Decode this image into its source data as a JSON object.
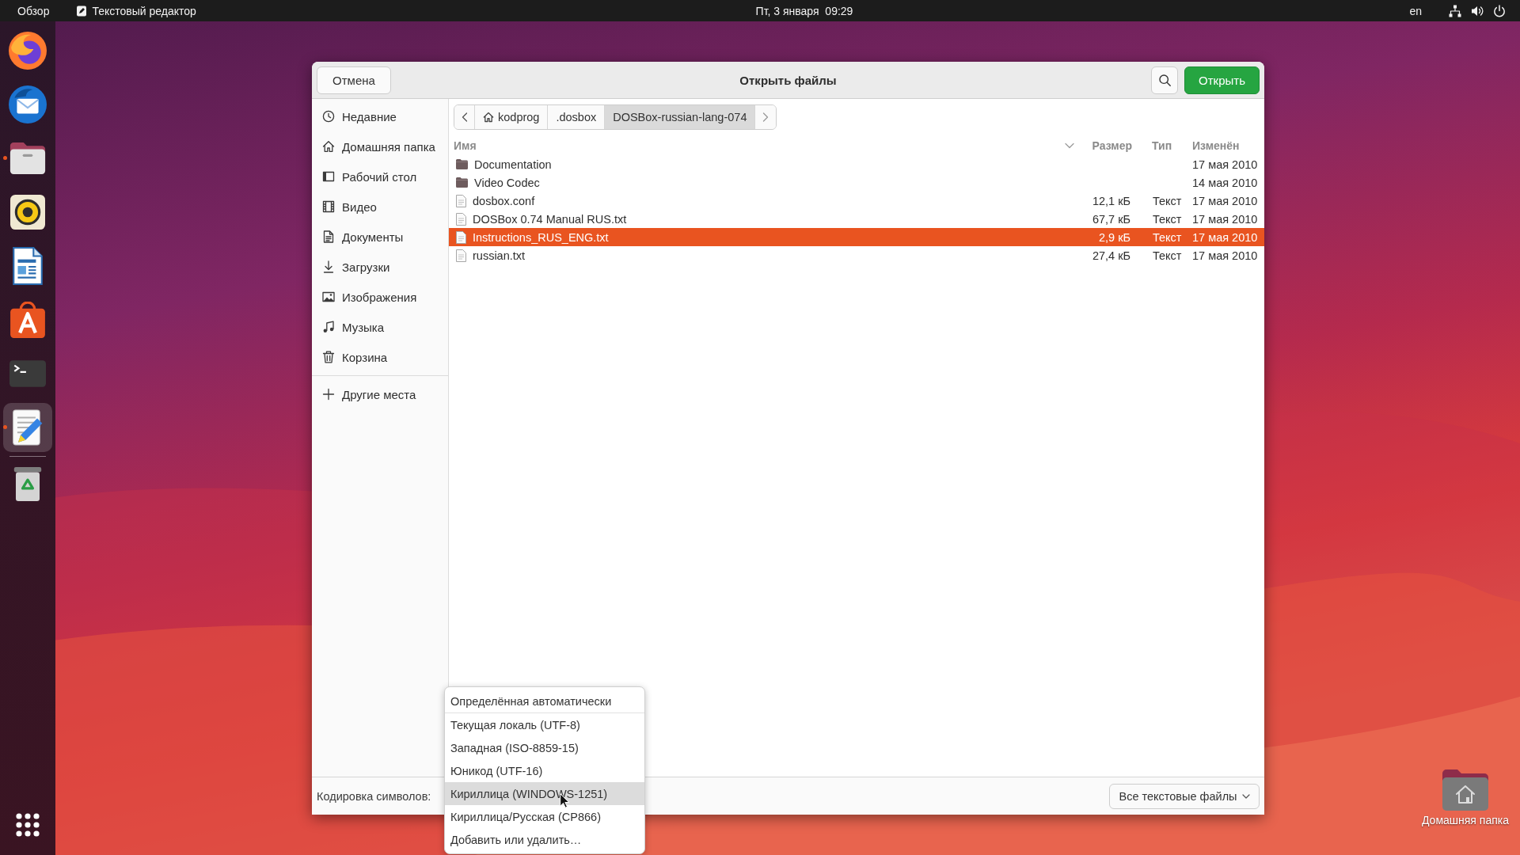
{
  "top_bar": {
    "activities": "Обзор",
    "app_menu": "Текстовый редактор",
    "clock": "Пт, 3 января  09:29",
    "keyboard_layout": "en"
  },
  "dock": {
    "apps": [
      {
        "kind": "browser",
        "running": false,
        "active": false
      },
      {
        "kind": "mail",
        "running": false,
        "active": false
      },
      {
        "kind": "files",
        "running": true,
        "active": false
      },
      {
        "kind": "music",
        "running": false,
        "active": false
      },
      {
        "kind": "writer",
        "running": false,
        "active": false
      },
      {
        "kind": "store",
        "running": false,
        "active": false
      },
      {
        "kind": "terminal",
        "running": false,
        "active": false
      },
      {
        "kind": "editor",
        "running": true,
        "active": true
      }
    ],
    "places": [
      {
        "kind": "trash",
        "running": false,
        "active": false
      }
    ]
  },
  "dialog": {
    "title": "Открыть файлы",
    "cancel_button": "Отмена",
    "open_button": "Открыть",
    "sidebar": {
      "places": [
        {
          "label": "Недавние",
          "kind": "recent",
          "selected": false
        },
        {
          "label": "Домашняя папка",
          "kind": "home",
          "selected": false
        },
        {
          "label": "Рабочий стол",
          "kind": "desktop",
          "selected": false
        },
        {
          "label": "Видео",
          "kind": "videos",
          "selected": false
        },
        {
          "label": "Документы",
          "kind": "documents",
          "selected": false
        },
        {
          "label": "Загрузки",
          "kind": "downloads",
          "selected": false
        },
        {
          "label": "Изображения",
          "kind": "pictures",
          "selected": false
        },
        {
          "label": "Музыка",
          "kind": "music",
          "selected": false
        },
        {
          "label": "Корзина",
          "kind": "trash",
          "selected": false
        }
      ],
      "other_locations": "Другие места"
    },
    "path_bar": {
      "segments": [
        {
          "label": "kodprog",
          "kind": "home",
          "selected": false
        },
        {
          "label": ".dosbox",
          "kind": "folder",
          "selected": false
        },
        {
          "label": "DOSBox-russian-lang-074",
          "kind": "folder",
          "selected": true
        }
      ]
    },
    "file_list": {
      "columns": [
        "Имя",
        "Размер",
        "Тип",
        "Изменён"
      ],
      "rows": [
        {
          "kind": "folder",
          "name": "Documentation",
          "modified": "17 мая 2010",
          "selected": false
        },
        {
          "kind": "folder",
          "name": "Video Codec",
          "modified": "14 мая 2010",
          "selected": false
        },
        {
          "kind": "file",
          "name": "dosbox.conf",
          "size": "12,1 кБ",
          "type": "Текст",
          "modified": "17 мая 2010",
          "selected": false
        },
        {
          "kind": "file",
          "name": "DOSBox 0.74 Manual RUS.txt",
          "size": "67,7 кБ",
          "type": "Текст",
          "modified": "17 мая 2010",
          "selected": false
        },
        {
          "kind": "file",
          "name": "Instructions_RUS_ENG.txt",
          "size": "2,9 кБ",
          "type": "Текст",
          "modified": "17 мая 2010",
          "selected": true
        },
        {
          "kind": "file",
          "name": "russian.txt",
          "size": "27,4 кБ",
          "type": "Текст",
          "modified": "17 мая 2010",
          "selected": false
        }
      ]
    },
    "footer": {
      "encoding_label": "Кодировка символов:",
      "filter": "Все текстовые файлы"
    },
    "encoding_menu": {
      "sections": [
        {
          "items": [
            {
              "label": "Определённая автоматически",
              "selected": false
            }
          ]
        },
        {
          "items": [
            {
              "label": "Текущая локаль (UTF-8)",
              "selected": false
            },
            {
              "label": "Западная (ISO-8859-15)",
              "selected": false
            },
            {
              "label": "Юникод (UTF-16)",
              "selected": false
            },
            {
              "label": "Кириллица (WINDOWS-1251)",
              "selected": true
            },
            {
              "label": "Кириллица/Русская (CP866)",
              "selected": false
            },
            {
              "label": "Добавить или удалить…",
              "selected": false
            }
          ]
        }
      ]
    }
  },
  "desktop_icons": [
    {
      "label": "Домашняя папка"
    }
  ]
}
